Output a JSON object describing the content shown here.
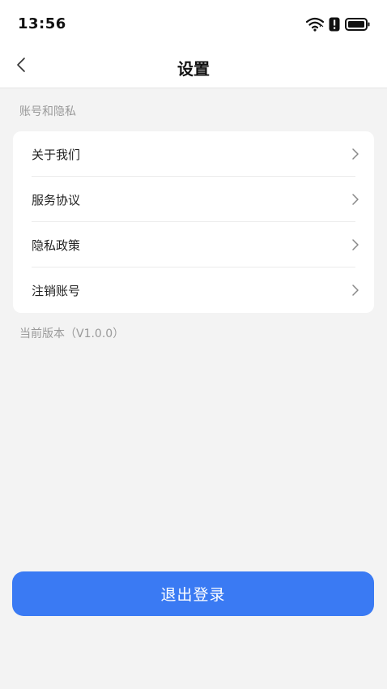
{
  "status_bar": {
    "time": "13:56",
    "icons": [
      "wifi-icon",
      "alert-icon",
      "battery-icon"
    ]
  },
  "nav": {
    "title": "设置",
    "back_icon": "chevron-left-icon"
  },
  "section": {
    "label": "账号和隐私",
    "items": [
      {
        "label": "关于我们"
      },
      {
        "label": "服务协议"
      },
      {
        "label": "隐私政策"
      },
      {
        "label": "注销账号"
      }
    ]
  },
  "version": {
    "text": "当前版本（V1.0.0）"
  },
  "logout": {
    "label": "退出登录"
  },
  "colors": {
    "accent": "#3a7af3",
    "background": "#f3f3f3",
    "card": "#ffffff",
    "muted_text": "#9a9a9a"
  }
}
